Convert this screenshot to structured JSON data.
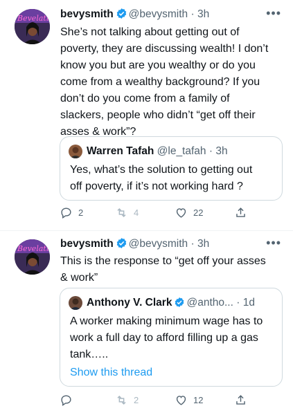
{
  "tweets": [
    {
      "author_name": "bevysmith",
      "handle": "@bevysmith",
      "time": "3h",
      "more": "•••",
      "lines": [
        "She’s not talking about getting out of",
        "poverty, they are discussing wealth!  I don’t",
        "know you but are you wealthy or do you",
        "come from a wealthy background?  If you",
        "don’t do you come from a family of",
        "slackers, people who didn’t “get off their",
        "asses & work”?"
      ],
      "quote": {
        "author_name": "Warren Tafah",
        "handle": "@le_tafah",
        "time": "3h",
        "lines": [
          "Yes, what’s the solution to getting out",
          "off poverty, if it’s not working hard ?"
        ]
      },
      "actions": {
        "replies": "2",
        "retweets": "4",
        "likes": "22"
      }
    },
    {
      "author_name": "bevysmith",
      "handle": "@bevysmith",
      "time": "3h",
      "more": "•••",
      "lines": [
        "This is the response to “get off your asses",
        "& work”"
      ],
      "quote": {
        "author_name": "Anthony V. Clark",
        "handle": "@antho...",
        "time": "1d",
        "lines": [
          "A worker making minimum wage has to",
          "work a full day to afford filling up a gas",
          "tank….."
        ],
        "show_thread": "Show this thread"
      },
      "actions": {
        "replies": "",
        "retweets": "2",
        "likes": "12"
      }
    }
  ],
  "colors": {
    "accent": "#1d9bf0",
    "secondary_text": "#536471",
    "border": "#cfd9de"
  }
}
